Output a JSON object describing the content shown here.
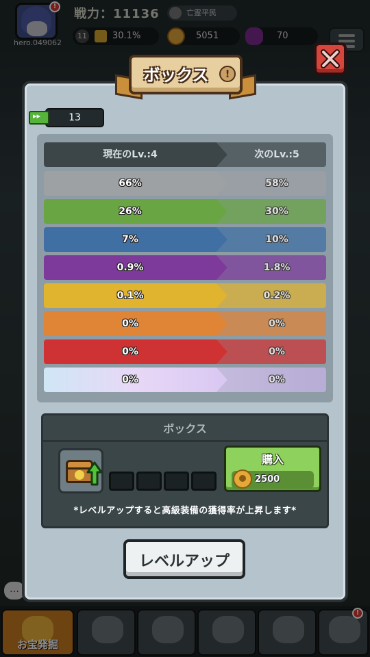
{
  "hud": {
    "power_label": "戦力：11136",
    "rank": "亡霊平民",
    "hero_id": "hero.049062",
    "level": "11",
    "level_progress": "30.1%",
    "coins": "5051",
    "gems": "70"
  },
  "dialog": {
    "title": "ボックス",
    "ticket_count": "13",
    "header": {
      "current": "現在のLv.:4",
      "next": "次のLv.:5"
    },
    "rates": [
      {
        "current": "66%",
        "next": "58%",
        "color": "#9ea1a3"
      },
      {
        "current": "26%",
        "next": "30%",
        "color": "#6aa544"
      },
      {
        "current": "7%",
        "next": "10%",
        "color": "#3f6fa3"
      },
      {
        "current": "0.9%",
        "next": "1.8%",
        "color": "#7d3a9a"
      },
      {
        "current": "0.1%",
        "next": "0.2%",
        "color": "#e0b42f"
      },
      {
        "current": "0%",
        "next": "0%",
        "color": "#e08436"
      },
      {
        "current": "0%",
        "next": "0%",
        "color": "#cf3232"
      },
      {
        "current": "0%",
        "next": "0%",
        "color": "#e6dcf5"
      }
    ],
    "box_panel": {
      "title": "ボックス",
      "buy_label": "購入",
      "price": "2500",
      "hint": "*レベルアップすると高級装備の獲得率が上昇します*",
      "progress_filled": 0,
      "progress_total": 4
    },
    "levelup_label": "レベルアップ"
  },
  "bottom_nav": {
    "treasure_label": "お宝発掘"
  }
}
